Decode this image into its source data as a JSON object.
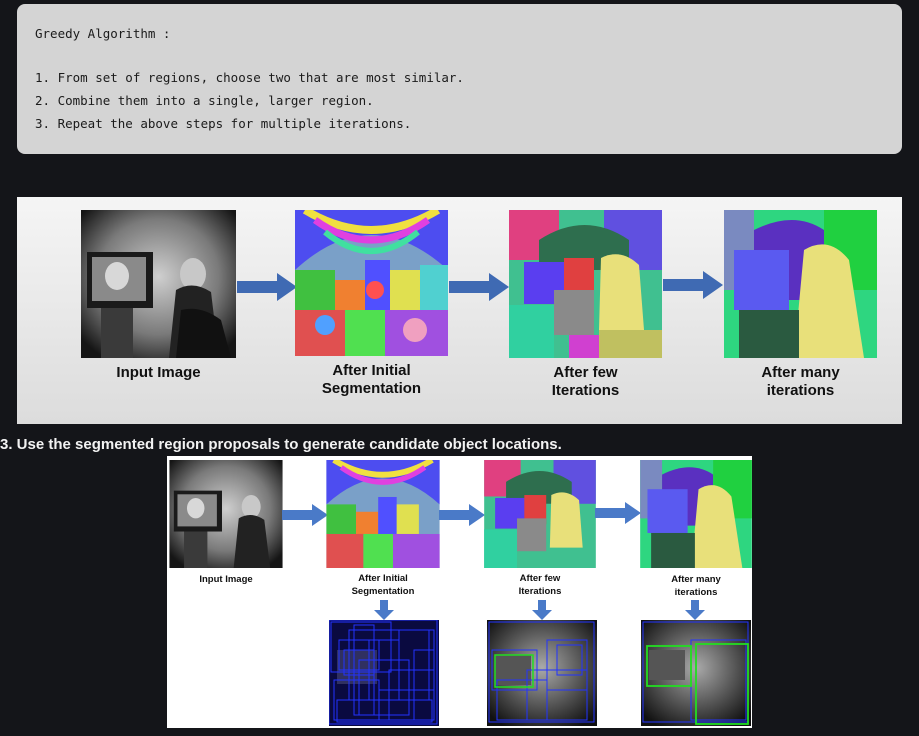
{
  "code_block": {
    "title": "Greedy Algorithm :",
    "steps": [
      "1. From set of regions, choose two that are most similar.",
      "2. Combine them into a single, larger region.",
      "3. Repeat the above steps for multiple iterations."
    ]
  },
  "figure1": {
    "labels": {
      "input": "Input Image",
      "initial_line1": "After Initial",
      "initial_line2": "Segmentation",
      "few_line1": "After few",
      "few_line2": "Iterations",
      "many_line1": "After many",
      "many_line2": "iterations"
    }
  },
  "heading": "3. Use the segmented region proposals to generate candidate object locations.",
  "figure2": {
    "labels": {
      "input": "Input Image",
      "initial_line1": "After Initial",
      "initial_line2": "Segmentation",
      "few_line1": "After few",
      "few_line2": "Iterations",
      "many_line1": "After many",
      "many_line2": "iterations"
    }
  },
  "colors": {
    "page_bg": "#141519",
    "code_bg": "#d4d4d4",
    "arrow": "#3f6ab3",
    "box_blue": "#2233ff",
    "box_green": "#22dd22"
  }
}
